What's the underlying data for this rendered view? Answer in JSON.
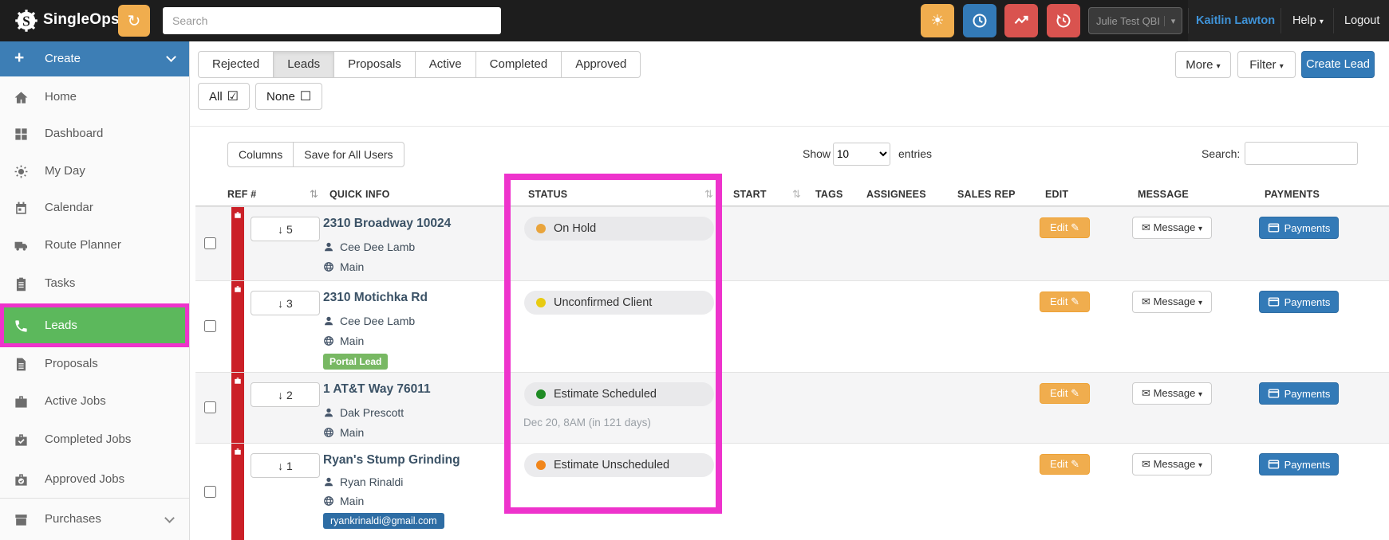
{
  "navbar": {
    "brand": "SingleOps",
    "search_placeholder": "Search",
    "account_name": "Julie Test QBI",
    "user_name": "Kaitlin Lawton",
    "help": "Help",
    "logout": "Logout"
  },
  "sidebar": {
    "create": "Create",
    "items": [
      {
        "label": "Home"
      },
      {
        "label": "Dashboard"
      },
      {
        "label": "My Day"
      },
      {
        "label": "Calendar"
      },
      {
        "label": "Route Planner"
      },
      {
        "label": "Tasks"
      },
      {
        "label": "Leads"
      },
      {
        "label": "Proposals"
      },
      {
        "label": "Active Jobs"
      },
      {
        "label": "Completed Jobs"
      },
      {
        "label": "Approved Jobs"
      },
      {
        "label": "Purchases"
      }
    ],
    "active_item": "Leads"
  },
  "tabs": {
    "items": [
      {
        "label": "Rejected"
      },
      {
        "label": "Leads"
      },
      {
        "label": "Proposals"
      },
      {
        "label": "Active"
      },
      {
        "label": "Completed"
      },
      {
        "label": "Approved"
      }
    ],
    "active": "Leads"
  },
  "select_buttons": {
    "all": "All",
    "none": "None"
  },
  "header_actions": {
    "more": "More",
    "filter": "Filter",
    "create_lead": "Create Lead"
  },
  "table_controls": {
    "columns": "Columns",
    "save_for_all": "Save for All Users",
    "show": "Show",
    "page_size": "10",
    "entries": "entries",
    "search_label": "Search:"
  },
  "table": {
    "headers": {
      "ref": "REF #",
      "quick_info": "QUICK INFO",
      "status": "STATUS",
      "start": "START",
      "tags": "TAGS",
      "assignees": "ASSIGNEES",
      "sales_rep": "SALES REP",
      "edit": "EDIT",
      "message": "MESSAGE",
      "payments": "PAYMENTS"
    },
    "row_buttons": {
      "edit": "Edit",
      "message": "Message",
      "payments": "Payments"
    },
    "rows": [
      {
        "ref": "5",
        "title": "2310 Broadway 10024",
        "contact": "Cee Dee Lamb",
        "location": "Main",
        "status": "On Hold",
        "status_color": "#e9a43c"
      },
      {
        "ref": "3",
        "title": "2310 Motichka Rd",
        "contact": "Cee Dee Lamb",
        "location": "Main",
        "status": "Unconfirmed Client",
        "status_color": "#e8cb12",
        "tag_badge": "Portal Lead"
      },
      {
        "ref": "2",
        "title": "1 AT&T Way 76011",
        "contact": "Dak Prescott",
        "location": "Main",
        "status": "Estimate Scheduled",
        "status_color": "#1f8b24",
        "start_note": "Dec 20, 8AM (in 121 days)"
      },
      {
        "ref": "1",
        "title": "Ryan's Stump Grinding",
        "contact": "Ryan Rinaldi",
        "location": "Main",
        "status": "Estimate Unscheduled",
        "status_color": "#f1861b",
        "email_badge": "ryankrinaldi@gmail.com"
      }
    ]
  },
  "icons": {
    "sort": "⇅",
    "caret": "▾",
    "check_square": "☑",
    "empty_square": "☐",
    "envelope": "✉",
    "pencil": "✎",
    "down_arrow": "↓",
    "plus": "+",
    "sun": "☀",
    "refresh": "↻"
  },
  "colors": {
    "accent_blue": "#337ab7",
    "warning_orange": "#f0ad4e",
    "danger_red": "#d9534f",
    "success_green": "#5cb85c",
    "annotation_pink": "#ee33cc",
    "portal_badge_green": "#78b863",
    "email_badge_blue": "#2e6da4",
    "red_bar": "#cb2027"
  }
}
